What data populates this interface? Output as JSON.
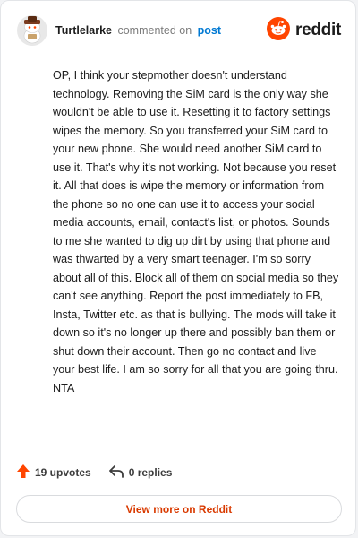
{
  "comment": {
    "username": "Turtlelarke",
    "verb": "commented on",
    "post_link": "post",
    "text": "OP, I think your stepmother doesn't understand technology. Removing the SiM card is the only way she wouldn't be able to use it. Resetting it to factory settings wipes the memory. So you transferred your SiM card to your new phone. She would need another SiM card to use it. That's why it's not working. Not because you reset it. All that does is wipe the memory or information from the phone so no one can use it to access your social media accounts, email, contact's list, or photos. Sounds to me she wanted to dig up dirt by using that phone and was thwarted by a very smart teenager. I'm so sorry about all of this. Block all of them on social media so they can't see anything. Report the post immediately to FB, Insta, Twitter etc. as that is bullying. The mods will take it down so it's no longer up there and possibly ban them or shut down their account. Then go no contact and live your best life. I am so sorry for all that you are going thru. NTA"
  },
  "brand": {
    "name": "reddit",
    "logo_icon": "reddit-snoo-icon",
    "accent": "#ff4500"
  },
  "actions": {
    "upvotes_label": "19 upvotes",
    "upvote_icon": "upvote-arrow-icon",
    "upvote_color": "#ff4500",
    "replies_label": "0 replies",
    "reply_icon": "reply-arrow-icon"
  },
  "footer": {
    "view_more_label": "View more on Reddit",
    "view_more_color": "#d93a00"
  }
}
